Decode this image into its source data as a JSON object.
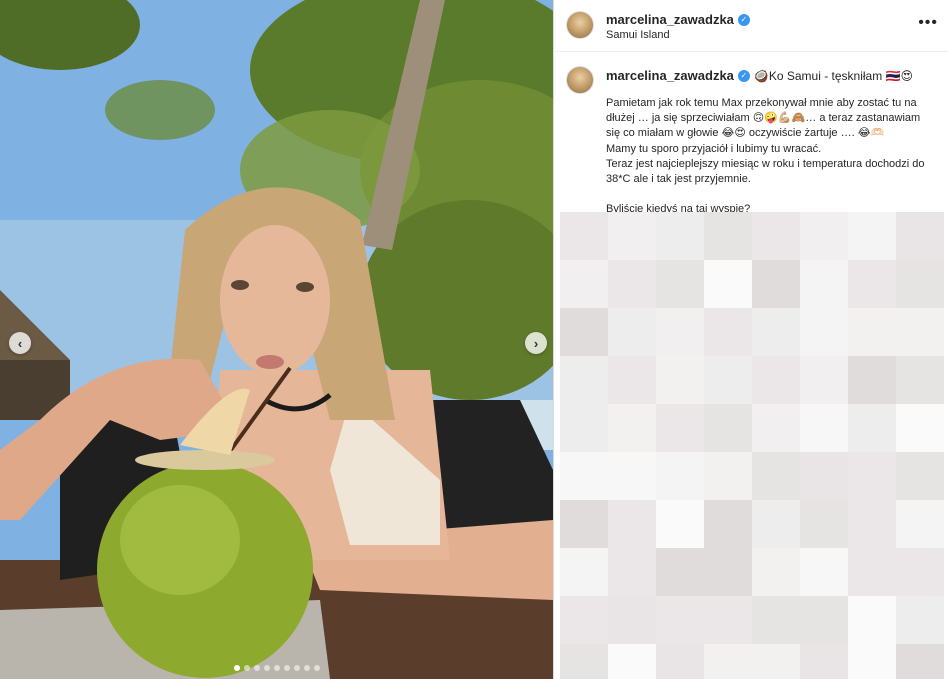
{
  "post": {
    "username": "marcelina_zawadzka",
    "verified": true,
    "location": "Samui Island",
    "more_label": "•••"
  },
  "caption": {
    "username": "marcelina_zawadzka",
    "title": "🥥Ko Samui - tęskniłam 🇹🇭😍",
    "lines": [
      "Pamietam jak rok temu Max przekonywał mnie aby zostać tu na dłużej … ja się sprzeciwiałam 🙃🤪💪🏼🙈… a teraz zastanawiam się co miałam w głowie 😂😍 oczywiście żartuje …. 😂🫶🏻",
      "Mamy tu sporo przyjaciół i lubimy tu wracać.",
      "Teraz jest najcieplejszy miesiąc w roku i temperatura dochodzi do 38*C ale i tak jest przyjemnie.",
      "Byliście kiedyś na taj wyspie?"
    ]
  },
  "carousel": {
    "prev_label": "‹",
    "next_label": "›",
    "slides": 9,
    "active_slide": 1
  },
  "colors": {
    "verified": "#3897f0",
    "border": "#dbdbdb",
    "text": "#262626"
  }
}
